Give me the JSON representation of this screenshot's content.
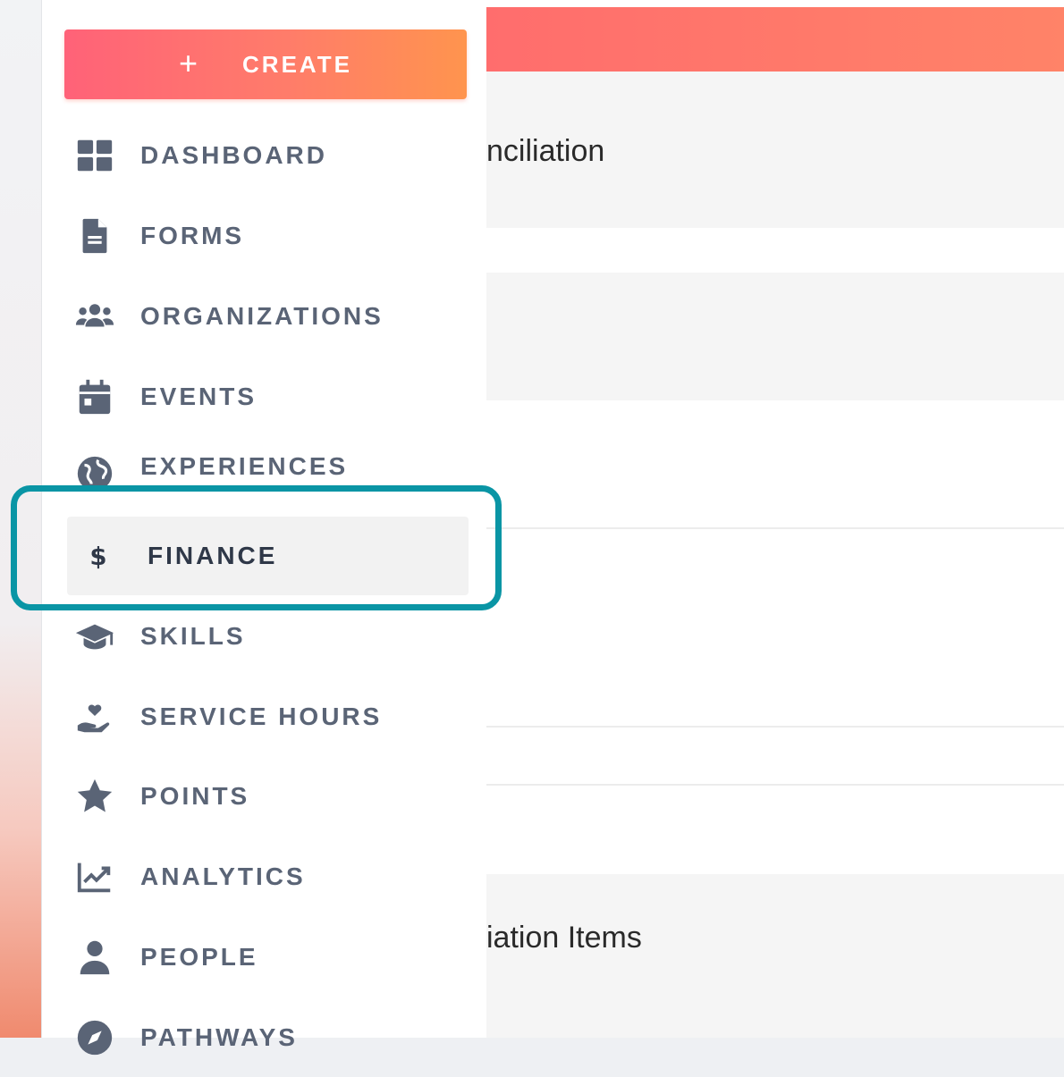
{
  "sidebar": {
    "create_icon": "plus-icon",
    "create_label": "CREATE",
    "items": [
      {
        "label": "DASHBOARD",
        "icon": "dashboard-icon"
      },
      {
        "label": "FORMS",
        "icon": "file-icon"
      },
      {
        "label": "ORGANIZATIONS",
        "icon": "users-icon"
      },
      {
        "label": "EVENTS",
        "icon": "calendar-icon"
      },
      {
        "label": "EXPERIENCES",
        "icon": "globe-icon"
      },
      {
        "label": "FINANCE",
        "icon": "dollar-icon",
        "active": true
      },
      {
        "label": "SKILLS",
        "icon": "graduation-cap-icon"
      },
      {
        "label": "SERVICE HOURS",
        "icon": "hand-heart-icon"
      },
      {
        "label": "POINTS",
        "icon": "star-icon"
      },
      {
        "label": "ANALYTICS",
        "icon": "chart-line-icon"
      },
      {
        "label": "PEOPLE",
        "icon": "person-icon"
      },
      {
        "label": "PATHWAYS",
        "icon": "compass-icon"
      }
    ]
  },
  "main": {
    "panel_1_title": "nciliation",
    "panel_2_title": "iation Items"
  },
  "colors": {
    "accent_gradient_start": "#ff6278",
    "accent_gradient_end": "#ff944e",
    "highlight_border": "#0a95a5",
    "nav_text": "#5a6476"
  }
}
